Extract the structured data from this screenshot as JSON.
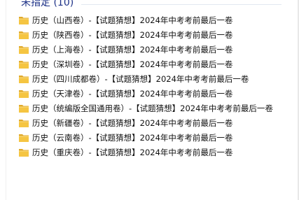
{
  "group": {
    "title": "未指定 (10)"
  },
  "items": [
    {
      "label": "历史（山西卷）-【试题猜想】2024年中考考前最后一卷",
      "icon": "folder-icon"
    },
    {
      "label": "历史（陕西卷）-【试题猜想】2024年中考考前最后一卷",
      "icon": "folder-icon"
    },
    {
      "label": "历史（上海卷）-【试题猜想】2024年中考考前最后一卷",
      "icon": "folder-icon"
    },
    {
      "label": "历史（深圳卷）-【试题猜想】2024年中考考前最后一卷",
      "icon": "folder-icon"
    },
    {
      "label": "历史（四川成都卷）-【试题猜想】2024年中考考前最后一卷",
      "icon": "folder-icon"
    },
    {
      "label": "历史（天津卷）-【试题猜想】2024年中考考前最后一卷",
      "icon": "folder-icon"
    },
    {
      "label": "历史（统编版全国通用卷）-【试题猜想】2024年中考考前最后一卷",
      "icon": "folder-icon"
    },
    {
      "label": "历史（新疆卷）-【试题猜想】2024年中考考前最后一卷",
      "icon": "folder-icon"
    },
    {
      "label": "历史（云南卷）-【试题猜想】2024年中考考前最后一卷",
      "icon": "folder-icon"
    },
    {
      "label": "历史（重庆卷）-【试题猜想】2024年中考考前最后一卷",
      "icon": "folder-icon"
    }
  ],
  "colors": {
    "group_title": "#1e3287",
    "folder_body": "#f5c542",
    "folder_tab": "#e0a92a"
  }
}
